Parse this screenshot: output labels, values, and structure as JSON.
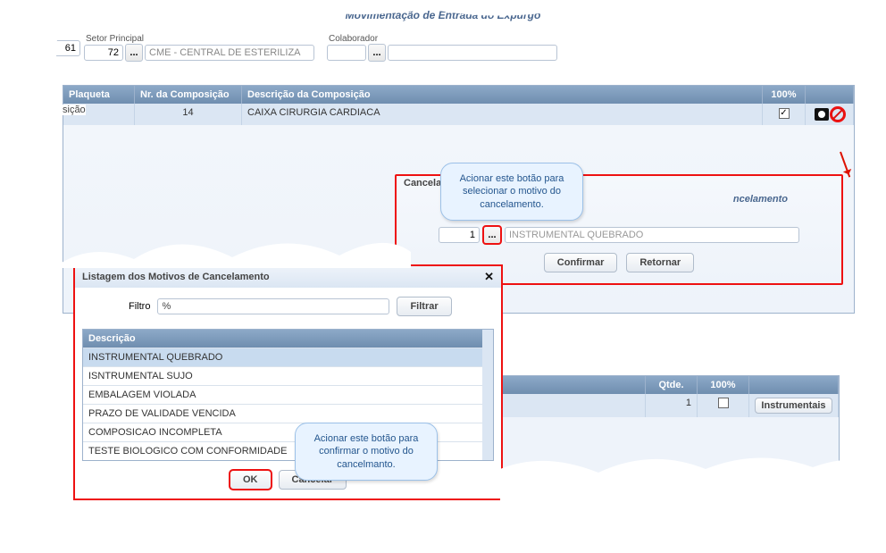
{
  "page_title": "Movimentação de Entrada do Expurgo",
  "form": {
    "seq": "61",
    "setor_label": "Setor Principal",
    "setor_value": "72",
    "setor_name": "CME - CENTRAL DE ESTERILIZA",
    "colaborador_label": "Colaborador",
    "colaborador_value": ""
  },
  "section_label": "sição",
  "grid1": {
    "headers": {
      "plaqueta": "Plaqueta",
      "nr": "Nr. da Composição",
      "desc": "Descrição da Composição",
      "pct": "100%"
    },
    "row": {
      "plaqueta": "",
      "nr": "14",
      "desc": "CAIXA CIRURGIA CARDIACA",
      "checked": true
    }
  },
  "callout1": "Acionar este botão para selecionar o motivo do cancelamento.",
  "cancel_panel": {
    "title_left": "Cancela",
    "title_right": "ncelamento",
    "code": "1",
    "motivo": "INSTRUMENTAL QUEBRADO",
    "confirm": "Confirmar",
    "return": "Retornar"
  },
  "modal": {
    "title": "Listagem dos Motivos de Cancelamento",
    "filter_label": "Filtro",
    "filter_value": "%",
    "filter_btn": "Filtrar",
    "col_desc": "Descrição",
    "rows": [
      "INSTRUMENTAL QUEBRADO",
      "ISNTRUMENTAL SUJO",
      "EMBALAGEM VIOLADA",
      "PRAZO DE VALIDADE VENCIDA",
      "COMPOSICAO INCOMPLETA",
      "TESTE BIOLOGICO COM CONFORMIDADE"
    ],
    "ok": "OK",
    "cancel": "Cancelar"
  },
  "callout2": "Acionar este botão para confirmar o motivo do cancelmanto.",
  "grid2": {
    "headers": {
      "qtde": "Qtde.",
      "pct": "100%",
      "action": "Instrumentais"
    },
    "row": {
      "qtde": "1",
      "checked": false
    }
  }
}
